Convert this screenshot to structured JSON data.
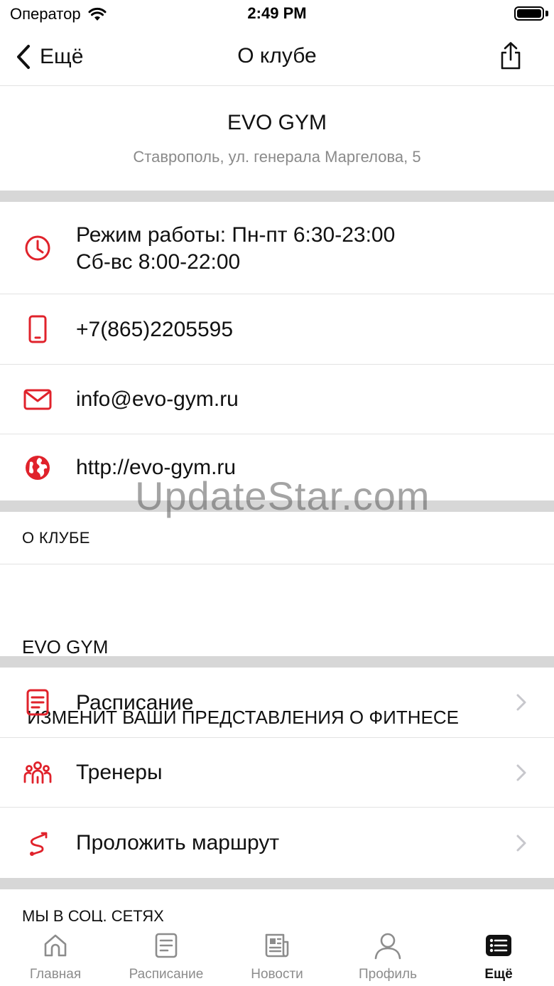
{
  "status_bar": {
    "carrier": "Оператор",
    "time": "2:49 PM"
  },
  "nav": {
    "back_label": "Ещё",
    "title": "О клубе"
  },
  "club": {
    "name": "EVO GYM",
    "address": "Ставрополь, ул. генерала Маргелова, 5"
  },
  "contacts": {
    "hours_line1": "Режим работы: Пн-пт 6:30-23:00",
    "hours_line2": "Сб-вс 8:00-22:00",
    "phone": "+7(865)2205595",
    "email": "info@evo-gym.ru",
    "website": "http://evo-gym.ru"
  },
  "about": {
    "section_title": "О КЛУБЕ",
    "text_line1": "EVO GYM",
    "text_line2": " ИЗМЕНИТ ВАШИ ПРЕДСТАВЛЕНИЯ О ФИТНЕСЕ"
  },
  "links": {
    "schedule": "Расписание",
    "trainers": "Тренеры",
    "route": "Проложить маршрут"
  },
  "social": {
    "section_title": "МЫ В СОЦ. СЕТЯХ"
  },
  "tabs": [
    {
      "label": "Главная",
      "icon": "home-icon"
    },
    {
      "label": "Расписание",
      "icon": "document-icon"
    },
    {
      "label": "Новости",
      "icon": "newspaper-icon"
    },
    {
      "label": "Профиль",
      "icon": "profile-icon"
    },
    {
      "label": "Ещё",
      "icon": "more-list-icon"
    }
  ],
  "active_tab": "Ещё",
  "watermark": "UpdateStar.com",
  "colors": {
    "accent": "#e0222b",
    "separator": "#d7d7d7",
    "muted_text": "#8a8a8a",
    "tab_inactive": "#8c8c8c"
  }
}
